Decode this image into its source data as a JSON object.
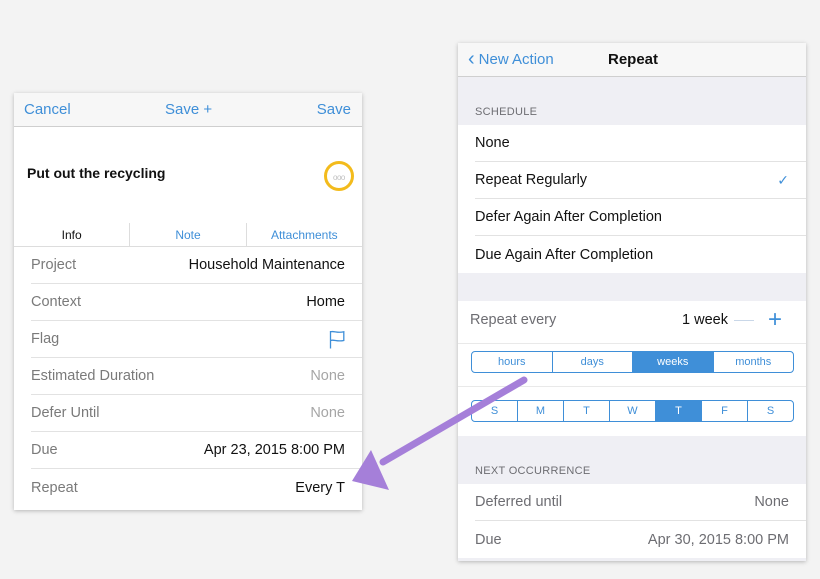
{
  "left": {
    "nav": {
      "cancel": "Cancel",
      "save_plus": "Save +",
      "save": "Save"
    },
    "title": "Put out the recycling",
    "status_dots": "ooo",
    "tabs": [
      "Info",
      "Note",
      "Attachments"
    ],
    "rows": [
      {
        "label": "Project",
        "value": "Household Maintenance"
      },
      {
        "label": "Context",
        "value": "Home"
      },
      {
        "label": "Flag",
        "icon": "flag-icon"
      },
      {
        "label": "Estimated Duration",
        "value": "None"
      },
      {
        "label": "Defer Until",
        "value": "None"
      },
      {
        "label": "Due",
        "value": "Apr 23, 2015  8:00 PM"
      },
      {
        "label": "Repeat",
        "value": "Every T"
      }
    ]
  },
  "right": {
    "nav": {
      "back": "New Action",
      "title": "Repeat"
    },
    "schedule_header": "SCHEDULE",
    "schedule_options": [
      "None",
      "Repeat Regularly",
      "Defer Again After Completion",
      "Due Again After Completion"
    ],
    "selected_option": "Repeat Regularly",
    "repeat_every": {
      "label": "Repeat every",
      "value": "1 week"
    },
    "units": [
      "hours",
      "days",
      "weeks",
      "months"
    ],
    "selected_unit": "weeks",
    "weekdays": [
      "S",
      "M",
      "T",
      "W",
      "T",
      "F",
      "S"
    ],
    "selected_weekday_index": 4,
    "next_header": "NEXT OCCURRENCE",
    "next_rows": [
      {
        "label": "Deferred until",
        "value": "None"
      },
      {
        "label": "Due",
        "value": "Apr 30, 2015  8:00 PM"
      }
    ]
  },
  "colors": {
    "accent": "#3f8fd8",
    "status_ring": "#f3bb1c",
    "arrow": "#a57fd9"
  }
}
